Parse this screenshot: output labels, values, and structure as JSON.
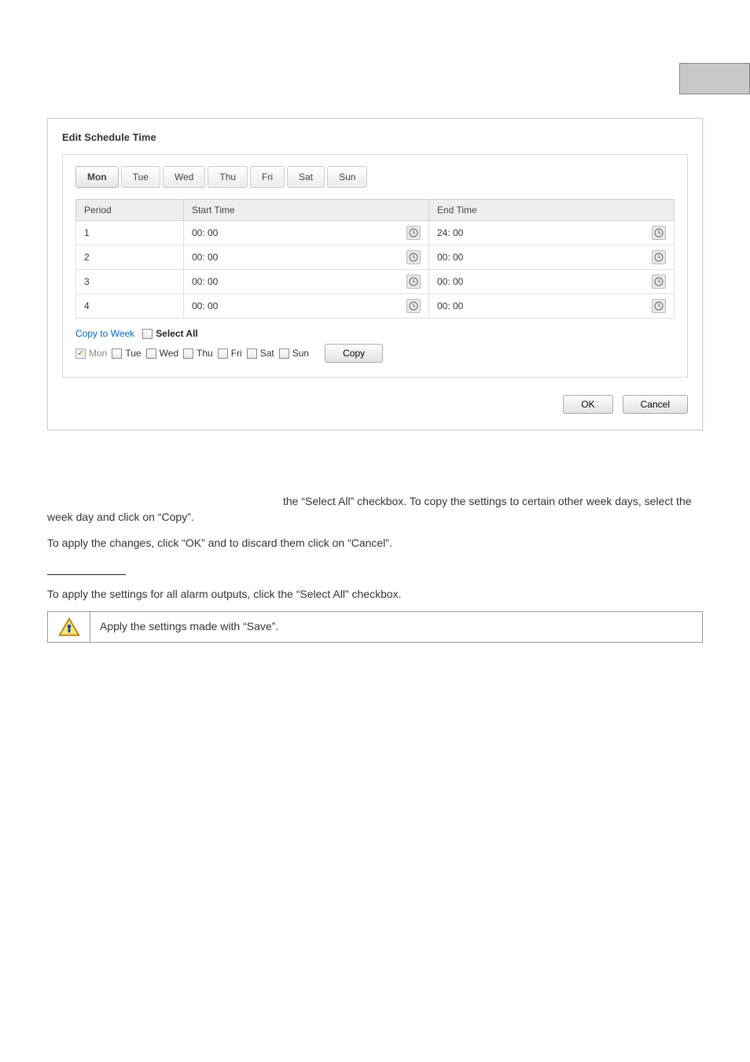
{
  "corner": {
    "label": ""
  },
  "dialog": {
    "title": "Edit Schedule Time",
    "tabs": [
      "Mon",
      "Tue",
      "Wed",
      "Thu",
      "Fri",
      "Sat",
      "Sun"
    ],
    "active_tab": "Mon",
    "headers": {
      "period": "Period",
      "start": "Start Time",
      "end": "End Time"
    },
    "rows": [
      {
        "period": "1",
        "start": "00: 00",
        "end": "24: 00"
      },
      {
        "period": "2",
        "start": "00: 00",
        "end": "00: 00"
      },
      {
        "period": "3",
        "start": "00: 00",
        "end": "00: 00"
      },
      {
        "period": "4",
        "start": "00: 00",
        "end": "00: 00"
      }
    ],
    "copy_to_week_label": "Copy to Week",
    "select_all_label": "Select All",
    "days": [
      {
        "label": "Mon",
        "checked": true,
        "disabled": true
      },
      {
        "label": "Tue",
        "checked": false,
        "disabled": false
      },
      {
        "label": "Wed",
        "checked": false,
        "disabled": false
      },
      {
        "label": "Thu",
        "checked": false,
        "disabled": false
      },
      {
        "label": "Fri",
        "checked": false,
        "disabled": false
      },
      {
        "label": "Sat",
        "checked": false,
        "disabled": false
      },
      {
        "label": "Sun",
        "checked": false,
        "disabled": false
      }
    ],
    "copy_btn": "Copy",
    "ok_btn": "OK",
    "cancel_btn": "Cancel"
  },
  "body": {
    "p1": "the “Select All” checkbox. To copy the settings to certain other week days, select the week day and click on “Copy”.",
    "p2": "To apply the changes, click “OK” and to discard them click on “Cancel”.",
    "p3": "To apply the settings for all alarm outputs, click the “Select All” checkbox.",
    "info": "Apply the settings made with “Save”."
  }
}
